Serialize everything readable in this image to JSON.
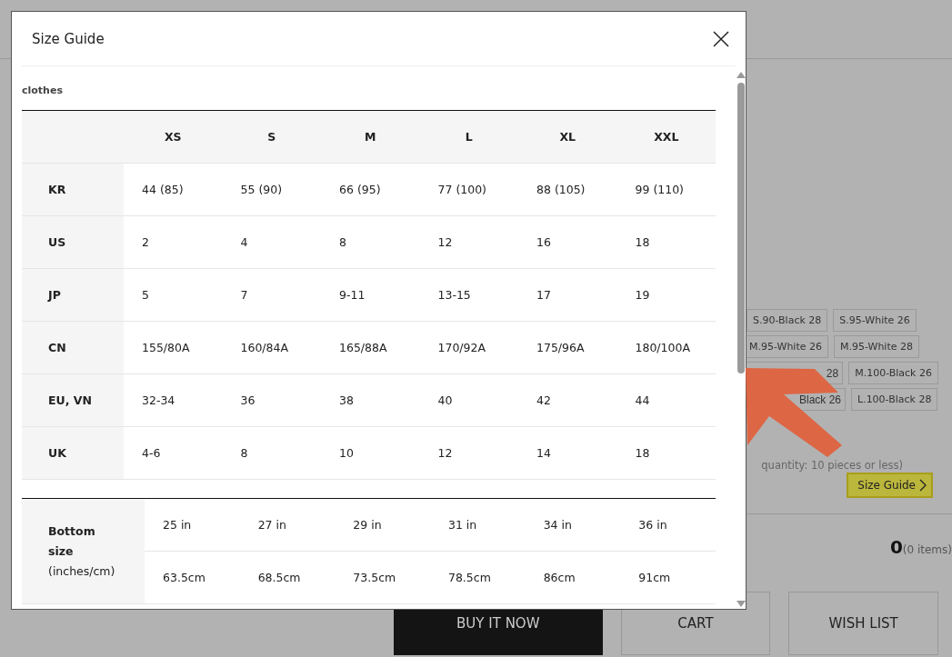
{
  "page": {
    "variants": [
      [
        "S.90-Black 28",
        "S.95-White 26"
      ],
      [
        "M.95-White 26",
        "M.95-White 28"
      ],
      [
        "28",
        "M.100-Black 26"
      ],
      [
        "Black 26",
        "L.100-Black 28"
      ]
    ],
    "quantity_note": "quantity: 10 pieces or less)",
    "size_guide_button": "Size Guide",
    "total": {
      "amount": "0",
      "count": "(0 items)"
    },
    "buttons": [
      {
        "label": "BUY IT NOW",
        "kind": "primary"
      },
      {
        "label": "CART",
        "kind": "outline"
      },
      {
        "label": "WISH LIST",
        "kind": "outline"
      }
    ]
  },
  "modal": {
    "title": "Size Guide",
    "section": "clothes",
    "size_table": {
      "columns": [
        "XS",
        "S",
        "M",
        "L",
        "XL",
        "XXL"
      ],
      "rows": [
        {
          "label": "KR",
          "cells": [
            "44 (85)",
            "55 (90)",
            "66 (95)",
            "77 (100)",
            "88 (105)",
            "99 (110)"
          ]
        },
        {
          "label": "US",
          "cells": [
            "2",
            "4",
            "8",
            "12",
            "16",
            "18"
          ]
        },
        {
          "label": "JP",
          "cells": [
            "5",
            "7",
            "9-11",
            "13-15",
            "17",
            "19"
          ]
        },
        {
          "label": "CN",
          "cells": [
            "155/80A",
            "160/84A",
            "165/88A",
            "170/92A",
            "175/96A",
            "180/100A"
          ]
        },
        {
          "label": "EU, VN",
          "cells": [
            "32-34",
            "36",
            "38",
            "40",
            "42",
            "44"
          ]
        },
        {
          "label": "UK",
          "cells": [
            "4-6",
            "8",
            "10",
            "12",
            "14",
            "18"
          ]
        }
      ]
    },
    "bottom_table": {
      "label": "**Bottom size** (inches/cm)",
      "rows": [
        [
          "25 in",
          "27 in",
          "29 in",
          "31 in",
          "34 in",
          "36 in"
        ],
        [
          "63.5cm",
          "68.5cm",
          "73.5cm",
          "78.5cm",
          "86cm",
          "91cm"
        ]
      ]
    }
  }
}
